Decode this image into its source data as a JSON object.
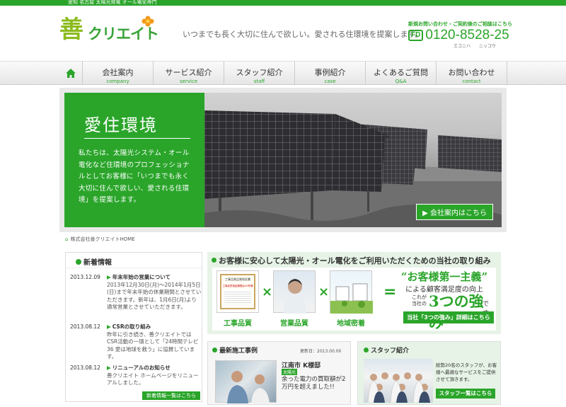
{
  "topbar": {
    "text": "愛知 名古屋 太陽光発電 オール電化専門"
  },
  "logo": {
    "kanji": "善",
    "kana": "クリエイト"
  },
  "tagline": "いつまでも長く大切に住んで欲しい。愛される住環境を提案します。",
  "contact": {
    "label": "新規お問い合わせ・ご契約後のご相談はこちら",
    "fd": "FD",
    "phone": "0120-8528-25",
    "reading": "エコニハ　　ニッコウ"
  },
  "nav": {
    "items": [
      {
        "jp": "会社案内",
        "en": "company"
      },
      {
        "jp": "サービス紹介",
        "en": "service"
      },
      {
        "jp": "スタッフ紹介",
        "en": "staff"
      },
      {
        "jp": "事例紹介",
        "en": "case"
      },
      {
        "jp": "よくあるご質問",
        "en": "Q&A"
      },
      {
        "jp": "お問い合わせ",
        "en": "contact"
      }
    ]
  },
  "hero": {
    "title": "愛住環境",
    "text": "私たちは、太陽光システム・オール電化など住環境のプロフェッショナルとしてお客様に「いつまでも永く大切に住んで欲しい、愛される住環境」を提案します。",
    "button": "会社案内はこちら"
  },
  "breadcrumb": "株式会社善クリエイトHOME",
  "news": {
    "heading": "新着情報",
    "entries": [
      {
        "date": "2013.12.09",
        "title": "年末年始の営業について",
        "desc": "2013年12月30日(月)〜2014年1月5日(日)まで年末年始の休業期間とさせていただきます。新年は、1月6日(月)より通常営業とさせていただきます。"
      },
      {
        "date": "2013.08.12",
        "title": "CSRの取り組み",
        "desc": "昨年に引き続き、善クリエイトではCSR活動の一環として「24時間テレビ36 愛は地球を救う」に協賛しています。"
      },
      {
        "date": "2013.08.12",
        "title": "リニューアルのお知らせ",
        "desc": "善クリエイト ホームページをリニューアルしました。"
      }
    ],
    "more": "新着情報一覧はこちら"
  },
  "strengths": {
    "heading": "お客様に安心して太陽光・オール電化をご利用いただくための当社の取り組み",
    "cert_title": "工事品質品質保証書",
    "cert_sub": "工事品質保証期間は10年間",
    "labels": [
      "工事品質",
      "営業品質",
      "地域密着"
    ],
    "x": "×",
    "eq": "=",
    "q1": "“お客様第一主義”",
    "q2": "による顧客満足度の向上",
    "q3a": "これが",
    "q3b": "当社の",
    "q4": "3つの強み",
    "q5": "です。",
    "button": "当社「3つの強み」詳細はこちら"
  },
  "cases": {
    "heading": "最新施工事例",
    "updated": "更新日：2013.00.00",
    "name": "江南市 K様邸",
    "tag": "太陽光",
    "desc": "余った電力の買取額が2万円を超えました!!"
  },
  "staff": {
    "heading": "スタッフ紹介",
    "desc": "総勢20名のスタッフが、お客様へ最適なサービスをご提供させて頂きます。",
    "button": "スタッフ一覧はこちら"
  }
}
